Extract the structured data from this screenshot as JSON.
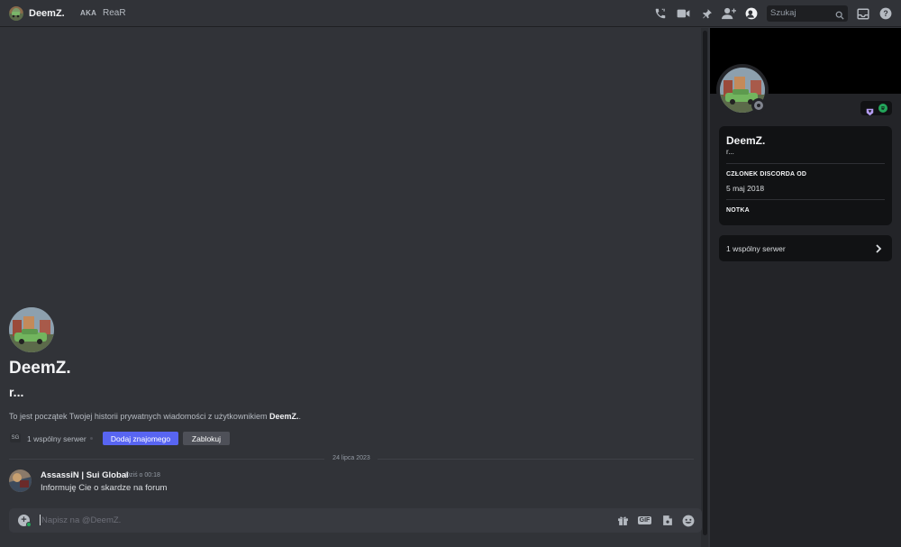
{
  "header": {
    "name": "DeemZ.",
    "aka_label": "AKA",
    "alias": "ReaR",
    "search_placeholder": "Szukaj"
  },
  "intro": {
    "name": "DeemZ.",
    "status_text": "r...",
    "description_prefix": "To jest początek Twojej historii prywatnych wiadomości z użytkownikiem ",
    "description_name": "DeemZ.",
    "description_suffix": ".",
    "mutual_icon_text": "SG",
    "mutual_servers": "1 wspólny serwer",
    "add_friend": "Dodaj znajomego",
    "block": "Zablokuj"
  },
  "divider_date": "24 lipca 2023",
  "message": {
    "author": "AssassiN | Sui Global",
    "timestamp": "Dziś o 00:18",
    "text": "Informuję Cie o skardze na forum"
  },
  "composer": {
    "placeholder": "Napisz na @DeemZ.",
    "gif_label": "GIF"
  },
  "profile": {
    "name": "DeemZ.",
    "status_text": "r...",
    "member_since_label": "CZŁONEK DISCORDA OD",
    "member_since_date": "5 maj 2018",
    "note_label": "NOTKA",
    "mutual_servers": "1 wspólny serwer"
  },
  "colors": {
    "background": "#313338",
    "panel": "#232428",
    "card": "#111214",
    "primary_button": "#5865f2",
    "secondary_button": "#4e5058",
    "online": "#23a55a"
  }
}
